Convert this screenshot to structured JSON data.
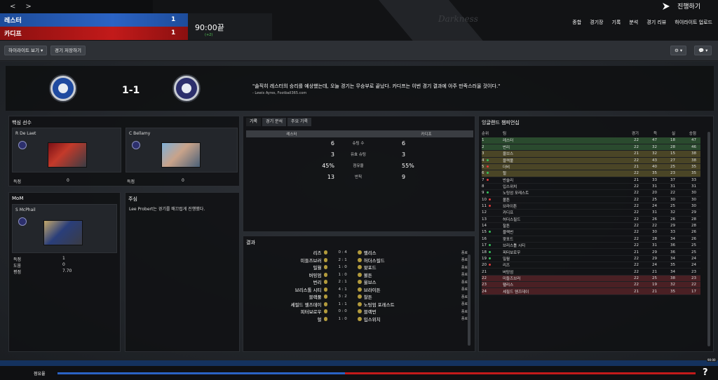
{
  "nav": {
    "back": "<",
    "forward": ">"
  },
  "match": {
    "home_team": "레스터",
    "away_team": "카디프",
    "home_score": "1",
    "away_score": "1",
    "time": "90:00끝",
    "added": "(+2)",
    "watermark": "Darkness",
    "continue_label": "진행하기"
  },
  "top_menu": [
    "종합",
    "경기장",
    "기록",
    "분석",
    "경기 리뷰",
    "하이라이트 업로드"
  ],
  "toolbar": {
    "highlights": "하이라이트 보기 ▾",
    "save_match": "경기 저장하기",
    "settings_icon": "⚙ ▾",
    "chat_icon": "💬 ▾"
  },
  "hero": {
    "score": "1-1",
    "quote": "\"솔직히 레스터의 승리를 예상했는데, 오늘 경기는 무승부로 끝났다. 카디프는 이번 경기 결과에 아주 만족스러울 것이다.\"",
    "quote_source": "- Lewis Ayres, Football365.com"
  },
  "key_players": {
    "title": "핵심 선수",
    "home": {
      "name": "R De Laet",
      "stat_label": "득점",
      "stat_value": "0"
    },
    "away": {
      "name": "C Bellamy",
      "stat_label": "득점",
      "stat_value": "0"
    }
  },
  "mom": {
    "title": "MoM",
    "name": "S McPhail",
    "stats": [
      {
        "label": "득점",
        "value": "1"
      },
      {
        "label": "도움",
        "value": "0"
      },
      {
        "label": "평점",
        "value": "7.70"
      }
    ]
  },
  "notes": {
    "title": "주심",
    "text": "Lee Probert는 경기를 매끄럽게 진행했다."
  },
  "stats": {
    "tabs": [
      "기록",
      "경기 분석",
      "주요 기록"
    ],
    "home": "레스터",
    "away": "카디프",
    "rows": [
      {
        "h": "6",
        "label": "슈팅 수",
        "a": "6"
      },
      {
        "h": "3",
        "label": "유효 슈팅",
        "a": "3"
      },
      {
        "h": "45%",
        "label": "점유율",
        "a": "55%"
      },
      {
        "h": "13",
        "label": "반칙",
        "a": "9"
      }
    ]
  },
  "results": {
    "title": "결과",
    "rows": [
      {
        "h": "리즈",
        "s": "0 : 4",
        "a": "팰리스",
        "t": "종료"
      },
      {
        "h": "미들즈브러",
        "s": "2 : 1",
        "a": "허더스필드",
        "t": "종료"
      },
      {
        "h": "밀월",
        "s": "1 : 0",
        "a": "왓포드",
        "t": "종료"
      },
      {
        "h": "버밍엄",
        "s": "1 : 0",
        "a": "볼튼",
        "t": "종료"
      },
      {
        "h": "번리",
        "s": "2 : 1",
        "a": "울브스",
        "t": "종료"
      },
      {
        "h": "브리스톨 시티",
        "s": "4 : 1",
        "a": "브라이튼",
        "t": "종료"
      },
      {
        "h": "블랙풀",
        "s": "3 : 2",
        "a": "찰튼",
        "t": "종료"
      },
      {
        "h": "셰필드 웬즈데이",
        "s": "1 : 1",
        "a": "노팅엄 포레스트",
        "t": "종료"
      },
      {
        "h": "피터보로우",
        "s": "0 : 0",
        "a": "블랙번",
        "t": "종료"
      },
      {
        "h": "헐",
        "s": "1 : 0",
        "a": "입스위치",
        "t": "종료"
      }
    ]
  },
  "league": {
    "title": "잉글랜드 챔피언십",
    "headers": [
      "순위",
      "팀",
      "경기",
      "득",
      "실",
      "승점"
    ],
    "rows": [
      {
        "pos": "1",
        "team": "레스터",
        "p": "22",
        "gf": "47",
        "ga": "18",
        "pts": "47",
        "zone": "cl",
        "mv": ""
      },
      {
        "pos": "2",
        "team": "번리",
        "p": "22",
        "gf": "32",
        "ga": "28",
        "pts": "46",
        "zone": "cl",
        "mv": ""
      },
      {
        "pos": "3",
        "team": "울브스",
        "p": "21",
        "gf": "32",
        "ga": "15",
        "pts": "38",
        "zone": "el",
        "mv": ""
      },
      {
        "pos": "4",
        "team": "블랙풀",
        "p": "22",
        "gf": "43",
        "ga": "27",
        "pts": "38",
        "zone": "el",
        "mv": "up"
      },
      {
        "pos": "5",
        "team": "더비",
        "p": "21",
        "gf": "40",
        "ga": "25",
        "pts": "35",
        "zone": "el",
        "mv": "dn"
      },
      {
        "pos": "6",
        "team": "헐",
        "p": "22",
        "gf": "35",
        "ga": "23",
        "pts": "35",
        "zone": "el",
        "mv": "up"
      },
      {
        "pos": "7",
        "team": "반슬리",
        "p": "21",
        "gf": "33",
        "ga": "37",
        "pts": "33",
        "zone": "",
        "mv": "dn"
      },
      {
        "pos": "8",
        "team": "입스위치",
        "p": "22",
        "gf": "31",
        "ga": "31",
        "pts": "31",
        "zone": "",
        "mv": ""
      },
      {
        "pos": "9",
        "team": "노팅엄 포레스트",
        "p": "22",
        "gf": "20",
        "ga": "22",
        "pts": "30",
        "zone": "",
        "mv": "up"
      },
      {
        "pos": "10",
        "team": "볼튼",
        "p": "22",
        "gf": "25",
        "ga": "30",
        "pts": "30",
        "zone": "",
        "mv": "dn"
      },
      {
        "pos": "11",
        "team": "브라이튼",
        "p": "22",
        "gf": "24",
        "ga": "25",
        "pts": "30",
        "zone": "",
        "mv": "dn"
      },
      {
        "pos": "12",
        "team": "카디프",
        "p": "22",
        "gf": "31",
        "ga": "32",
        "pts": "29",
        "zone": "",
        "mv": "",
        "me": true
      },
      {
        "pos": "13",
        "team": "허더스필드",
        "p": "22",
        "gf": "26",
        "ga": "26",
        "pts": "28",
        "zone": "",
        "mv": ""
      },
      {
        "pos": "14",
        "team": "찰튼",
        "p": "22",
        "gf": "22",
        "ga": "29",
        "pts": "28",
        "zone": "",
        "mv": ""
      },
      {
        "pos": "15",
        "team": "블랙번",
        "p": "22",
        "gf": "30",
        "ga": "33",
        "pts": "26",
        "zone": "",
        "mv": "up"
      },
      {
        "pos": "16",
        "team": "왓포드",
        "p": "22",
        "gf": "28",
        "ga": "34",
        "pts": "26",
        "zone": "",
        "mv": ""
      },
      {
        "pos": "17",
        "team": "브리스톨 시티",
        "p": "22",
        "gf": "31",
        "ga": "36",
        "pts": "25",
        "zone": "",
        "mv": "up"
      },
      {
        "pos": "18",
        "team": "피터보로우",
        "p": "21",
        "gf": "29",
        "ga": "36",
        "pts": "25",
        "zone": "",
        "mv": "up"
      },
      {
        "pos": "19",
        "team": "밀월",
        "p": "22",
        "gf": "29",
        "ga": "34",
        "pts": "24",
        "zone": "",
        "mv": "up"
      },
      {
        "pos": "20",
        "team": "리즈",
        "p": "22",
        "gf": "24",
        "ga": "35",
        "pts": "24",
        "zone": "",
        "mv": "dn"
      },
      {
        "pos": "21",
        "team": "버밍엄",
        "p": "22",
        "gf": "21",
        "ga": "34",
        "pts": "23",
        "zone": "",
        "mv": ""
      },
      {
        "pos": "22",
        "team": "미들즈브러",
        "p": "22",
        "gf": "25",
        "ga": "38",
        "pts": "23",
        "zone": "rel",
        "mv": ""
      },
      {
        "pos": "23",
        "team": "팰리스",
        "p": "22",
        "gf": "19",
        "ga": "32",
        "pts": "22",
        "zone": "rel",
        "mv": ""
      },
      {
        "pos": "24",
        "team": "셰필드 웬즈데이",
        "p": "21",
        "gf": "21",
        "ga": "35",
        "pts": "17",
        "zone": "rel",
        "mv": ""
      }
    ]
  },
  "bottom": {
    "possession_label": "점유율",
    "home_possession": 0.45,
    "help": "?",
    "clock": "90:00"
  },
  "colors": {
    "home": "#2b63c4",
    "away": "#c21a1a"
  }
}
